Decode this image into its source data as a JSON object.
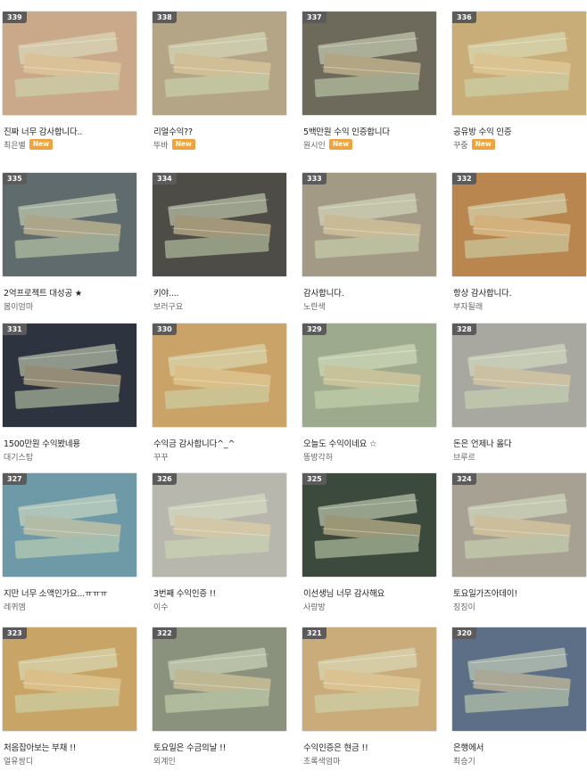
{
  "posts": [
    {
      "num": "339",
      "title": "진짜 너무 감사합니다..",
      "author": "최은별",
      "badge": "New",
      "color": "#c9a98a"
    },
    {
      "num": "338",
      "title": "리얼수익??",
      "author": "뚜바",
      "badge": "New",
      "color": "#b3a585"
    },
    {
      "num": "337",
      "title": "5백만원 수익 인증합니다",
      "author": "원시인",
      "badge": "New",
      "color": "#6d6a5c"
    },
    {
      "num": "336",
      "title": "공유방 수익 인증",
      "author": "꾸중",
      "badge": "New",
      "color": "#c8ad78"
    },
    {
      "num": "335",
      "title": "2억프로젝트 대성공 ★",
      "author": "봄이엄마",
      "badge": "",
      "color": "#5f6b6c"
    },
    {
      "num": "334",
      "title": "키야....",
      "author": "보러구요",
      "badge": "",
      "color": "#4d4c46"
    },
    {
      "num": "333",
      "title": "감사합니다.",
      "author": "노란색",
      "badge": "",
      "color": "#a39a85"
    },
    {
      "num": "332",
      "title": "항상 감사합니다.",
      "author": "부자될래",
      "badge": "",
      "color": "#b9864f"
    },
    {
      "num": "331",
      "title": "1500만원 수익봤네용",
      "author": "대기스탑",
      "badge": "",
      "color": "#2e3340"
    },
    {
      "num": "330",
      "title": "수익금 감사합니다^_^",
      "author": "꾸꾸",
      "badge": "",
      "color": "#c9a367"
    },
    {
      "num": "329",
      "title": "오늘도 수익이네요 ☆",
      "author": "똥방각하",
      "badge": "",
      "color": "#9eaa8d"
    },
    {
      "num": "328",
      "title": "돈은 언제나 옳다",
      "author": "브루르",
      "badge": "",
      "color": "#a8a8a1"
    },
    {
      "num": "327",
      "title": "지만 너무 소액인가요...ㅠㅠㅠ",
      "author": "레퀴엠",
      "badge": "",
      "color": "#6e9aa7"
    },
    {
      "num": "326",
      "title": "3번째 수익인증 !!",
      "author": "이수",
      "badge": "",
      "color": "#b8b7ad"
    },
    {
      "num": "325",
      "title": "이선생님 너무 감사해요",
      "author": "사랑방",
      "badge": "",
      "color": "#3c4a3e"
    },
    {
      "num": "324",
      "title": "토요일가즈아데이!",
      "author": "징징이",
      "badge": "",
      "color": "#a7a194"
    },
    {
      "num": "323",
      "title": "처음잡아보는 부채 !!",
      "author": "얼유쌍디",
      "badge": "",
      "color": "#c8a567"
    },
    {
      "num": "322",
      "title": "토요일은 수금의날 !!",
      "author": "외계인",
      "badge": "",
      "color": "#8a927e"
    },
    {
      "num": "321",
      "title": "수익인증은 현금 !!",
      "author": "초록색엄마",
      "badge": "",
      "color": "#c9ac7a"
    },
    {
      "num": "320",
      "title": "은행에서",
      "author": "최승기",
      "badge": "",
      "color": "#5d6f86"
    }
  ]
}
